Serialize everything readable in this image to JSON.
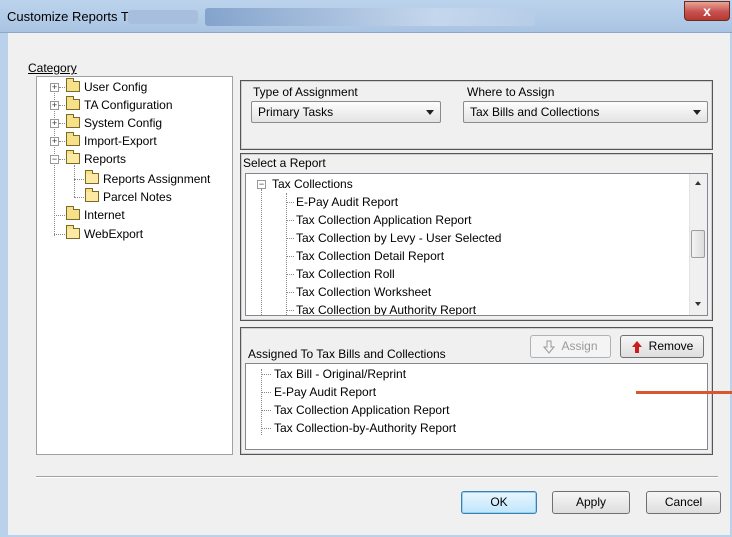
{
  "window": {
    "title": "Customize Reports Tab",
    "close_glyph": "x"
  },
  "category": {
    "label": "Category",
    "items": [
      {
        "label": "User Config"
      },
      {
        "label": "TA Configuration"
      },
      {
        "label": "System Config"
      },
      {
        "label": "Import-Export"
      },
      {
        "label": "Reports"
      },
      {
        "label": "Reports Assignment"
      },
      {
        "label": "Parcel Notes"
      },
      {
        "label": "Internet"
      },
      {
        "label": "WebExport"
      }
    ]
  },
  "assignment": {
    "type_label": "Type of Assignment",
    "type_value": "Primary Tasks",
    "where_label": "Where to Assign",
    "where_value": "Tax Bills and Collections"
  },
  "select_report": {
    "label": "Select a Report",
    "group": "Tax Collections",
    "items": [
      "E-Pay Audit Report",
      "Tax Collection Application Report",
      "Tax Collection by Levy - User Selected",
      "Tax Collection Detail Report",
      "Tax Collection Roll",
      "Tax Collection Worksheet",
      "Tax Collection by Authority Report"
    ]
  },
  "assigned": {
    "label": "Assigned To Tax Bills and Collections",
    "assign_label": "Assign",
    "remove_label": "Remove",
    "items": [
      "Tax Bill - Original/Reprint",
      "E-Pay Audit Report",
      "Tax Collection Application Report",
      "Tax Collection-by-Authority Report"
    ]
  },
  "footer": {
    "ok_label": "OK",
    "apply_label": "Apply",
    "cancel_label": "Cancel"
  },
  "colors": {
    "accent": "#3c7fb1",
    "remove_arrow": "#c81e1e",
    "annotation_line": "#d9572f"
  }
}
